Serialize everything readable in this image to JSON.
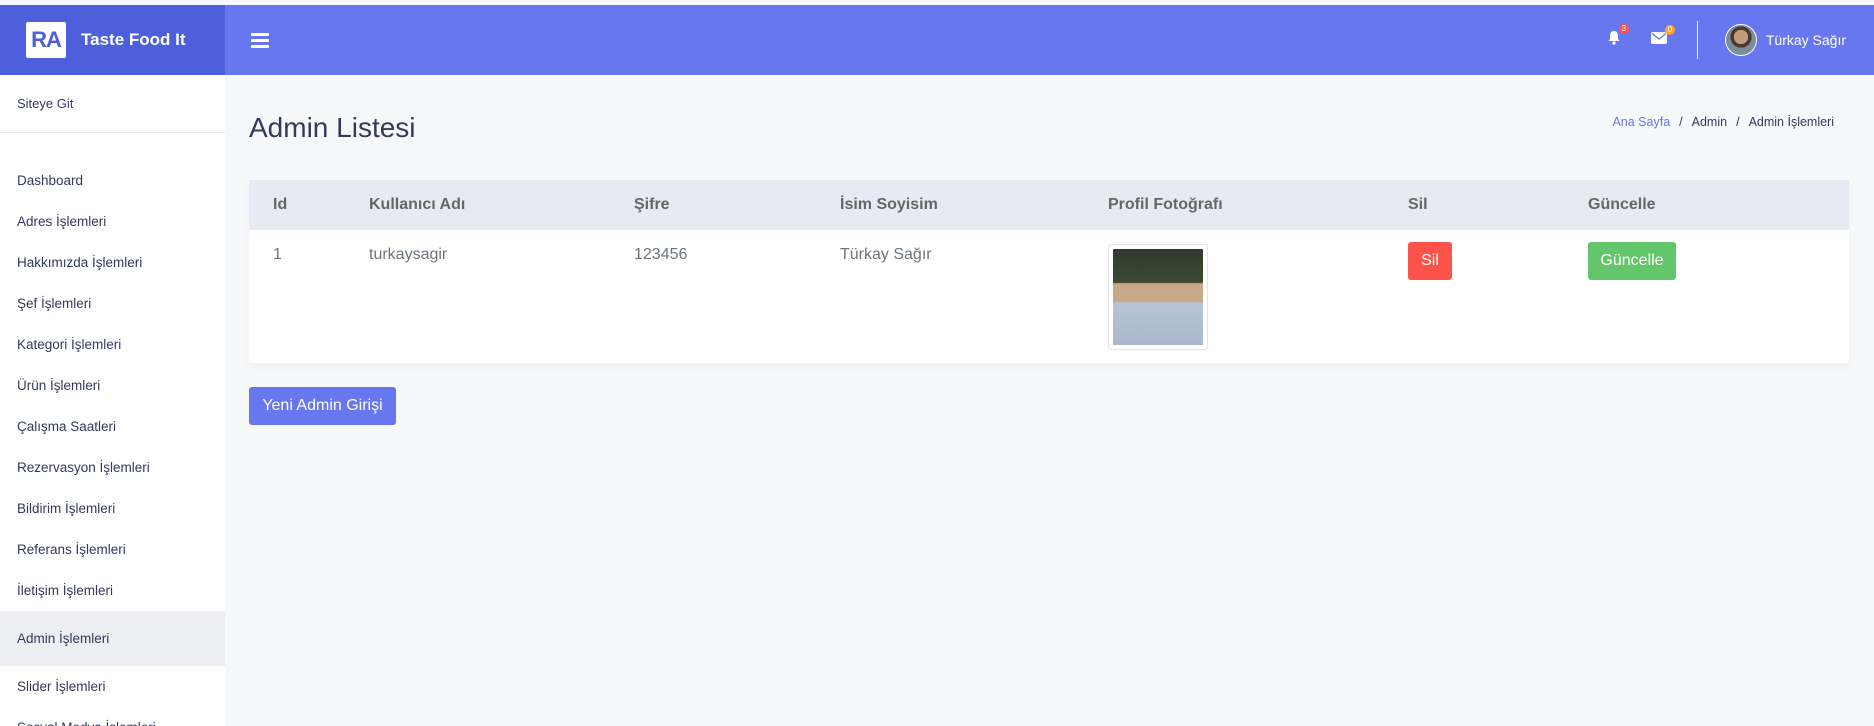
{
  "brand": {
    "logo_text": "RA",
    "title": "Taste Food It"
  },
  "topbar": {
    "menu_icon": "hamburger-icon",
    "notifications": {
      "icon": "bell-icon",
      "count": "3"
    },
    "messages": {
      "icon": "envelope-icon",
      "count": "0"
    },
    "user_name": "Türkay Sağır"
  },
  "sidebar": {
    "top_link": "Siteye Git",
    "items": [
      {
        "label": "Dashboard"
      },
      {
        "label": "Adres İşlemleri"
      },
      {
        "label": "Hakkımızda İşlemleri"
      },
      {
        "label": "Şef İşlemleri"
      },
      {
        "label": "Kategori İşlemleri"
      },
      {
        "label": "Ürün İşlemleri"
      },
      {
        "label": "Çalışma Saatleri"
      },
      {
        "label": "Rezervasyon İşlemleri"
      },
      {
        "label": "Bildirim İşlemleri"
      },
      {
        "label": "Referans İşlemleri"
      },
      {
        "label": "İletişim İşlemleri"
      },
      {
        "label": "Admin İşlemleri",
        "active": true
      },
      {
        "label": "Slider İşlemleri"
      },
      {
        "label": "Sosyal Medya İşlemleri"
      }
    ]
  },
  "page": {
    "title": "Admin Listesi",
    "breadcrumb": [
      "Ana Sayfa",
      "Admin",
      "Admin İşlemleri"
    ]
  },
  "table": {
    "headers": [
      "Id",
      "Kullanıcı Adı",
      "Şifre",
      "İsim Soyisim",
      "Profil Fotoğrafı",
      "Sil",
      "Güncelle"
    ],
    "rows": [
      {
        "id": "1",
        "username": "turkaysagir",
        "password": "123456",
        "fullname": "Türkay Sağır",
        "delete_label": "Sil",
        "update_label": "Güncelle"
      }
    ]
  },
  "actions": {
    "new_admin_label": "Yeni Admin Girişi"
  },
  "colors": {
    "primary": "#6777ef",
    "brand_dark": "#4d5fdb",
    "danger": "#fc544b",
    "success": "#63c66b"
  }
}
